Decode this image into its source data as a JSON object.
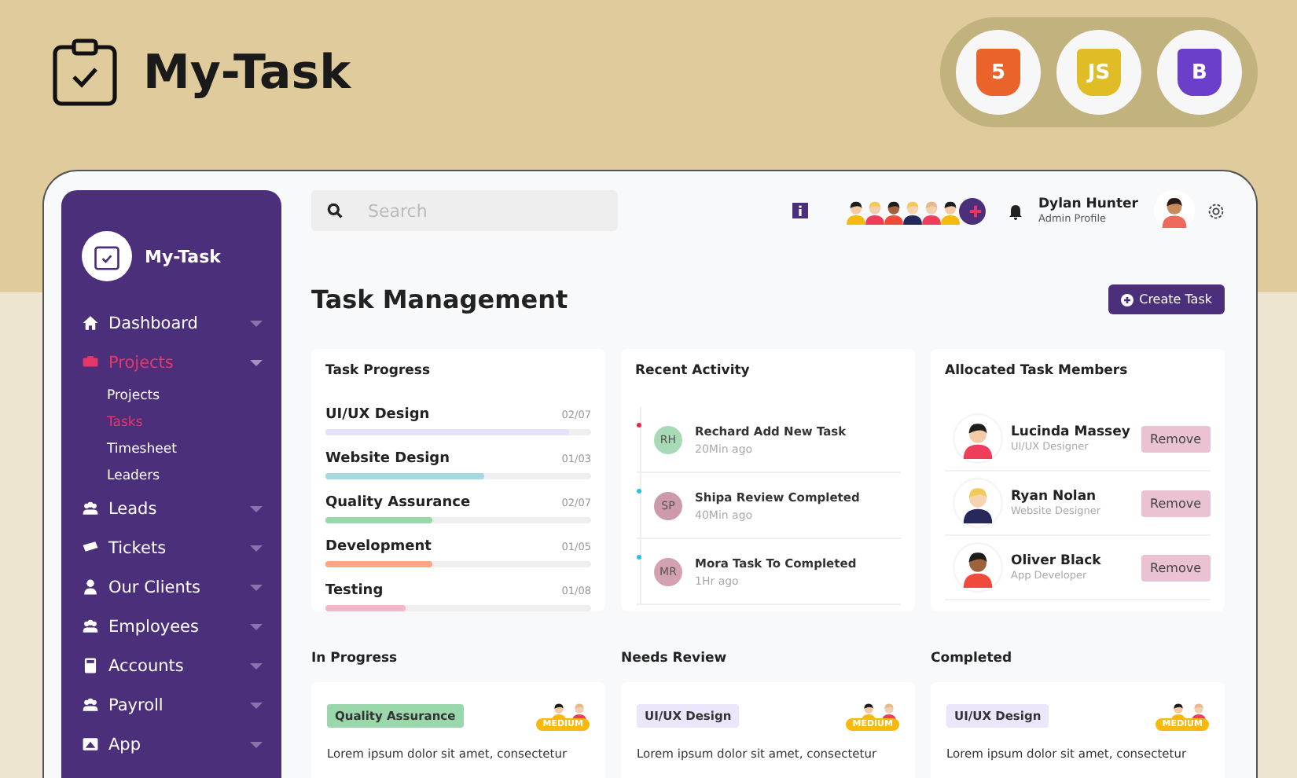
{
  "banner": {
    "title": "My-Task",
    "tech_badges": [
      {
        "kind": "html",
        "label": "5"
      },
      {
        "kind": "js",
        "label": "JS"
      },
      {
        "kind": "bootstrap",
        "label": "B"
      }
    ]
  },
  "sidebar": {
    "brand": "My-Task",
    "items": [
      {
        "kind": "home",
        "label": "Dashboard",
        "selected": false,
        "expanded": false
      },
      {
        "kind": "projects",
        "label": "Projects",
        "selected": true,
        "expanded": true,
        "children": [
          {
            "label": "Projects",
            "selected": false
          },
          {
            "label": "Tasks",
            "selected": true
          },
          {
            "label": "Timesheet",
            "selected": false
          },
          {
            "label": "Leaders",
            "selected": false
          }
        ]
      },
      {
        "kind": "group",
        "label": "Leads",
        "selected": false,
        "expanded": false
      },
      {
        "kind": "ticket",
        "label": "Tickets",
        "selected": false,
        "expanded": false
      },
      {
        "kind": "person",
        "label": "Our Clients",
        "selected": false,
        "expanded": false
      },
      {
        "kind": "group",
        "label": "Employees",
        "selected": false,
        "expanded": false
      },
      {
        "kind": "calculator",
        "label": "Accounts",
        "selected": false,
        "expanded": false
      },
      {
        "kind": "group",
        "label": "Payroll",
        "selected": false,
        "expanded": false
      },
      {
        "kind": "app",
        "label": "App",
        "selected": false,
        "expanded": false
      }
    ]
  },
  "topbar": {
    "search": {
      "placeholder": "Search"
    },
    "user": {
      "name": "Dylan Hunter",
      "role": "Admin Profile"
    }
  },
  "page": {
    "title": "Task Management",
    "create_button": "Create Task"
  },
  "task_progress": {
    "title": "Task Progress",
    "items": [
      {
        "label": "UI/UX Design",
        "count": "02/07",
        "level": 0.92,
        "color": "#e6e0fb"
      },
      {
        "label": "Website Design",
        "count": "01/03",
        "level": 0.6,
        "color": "#a6d8e0"
      },
      {
        "label": "Quality Assurance",
        "count": "02/07",
        "level": 0.4,
        "color": "#9ad7aa"
      },
      {
        "label": "Development",
        "count": "01/05",
        "level": 0.4,
        "color": "#f9a77f"
      },
      {
        "label": "Testing",
        "count": "01/08",
        "level": 0.3,
        "color": "#f4b6c8"
      }
    ]
  },
  "recent_activity": {
    "title": "Recent Activity",
    "items": [
      {
        "initials": "RH",
        "text": "Rechard Add New Task",
        "time": "20Min ago",
        "color": "#a8dbb5",
        "kind": "new"
      },
      {
        "initials": "SP",
        "text": "Shipa Review Completed",
        "time": "40Min ago",
        "color": "#cc9aab",
        "kind": "done"
      },
      {
        "initials": "MR",
        "text": "Mora Task To Completed",
        "time": "1Hr ago",
        "color": "#d4a1b1",
        "kind": "done"
      }
    ]
  },
  "members": {
    "title": "Allocated Task Members",
    "items": [
      {
        "kind": "woman",
        "name": "Lucinda Massey",
        "role": "UI/UX Designer",
        "button": "Remove"
      },
      {
        "kind": "man",
        "name": "Ryan Nolan",
        "role": "Website Designer",
        "button": "Remove"
      },
      {
        "kind": "man_dark",
        "name": "Oliver Black",
        "role": "App Developer",
        "button": "Remove"
      }
    ]
  },
  "board": [
    {
      "title": "In Progress",
      "cards": [
        {
          "tag": "Quality Assurance",
          "color": "#9ad7aa",
          "priority": "MEDIUM",
          "text": "Lorem ipsum dolor sit amet, consectetur"
        }
      ]
    },
    {
      "title": "Needs Review",
      "cards": [
        {
          "tag": "UI/UX Design",
          "color": "#ece6fc",
          "priority": "MEDIUM",
          "text": "Lorem ipsum dolor sit amet, consectetur"
        }
      ]
    },
    {
      "title": "Completed",
      "cards": [
        {
          "tag": "UI/UX Design",
          "color": "#ece6fc",
          "priority": "MEDIUM",
          "text": "Lorem ipsum dolor sit amet, consectetur"
        }
      ]
    }
  ]
}
